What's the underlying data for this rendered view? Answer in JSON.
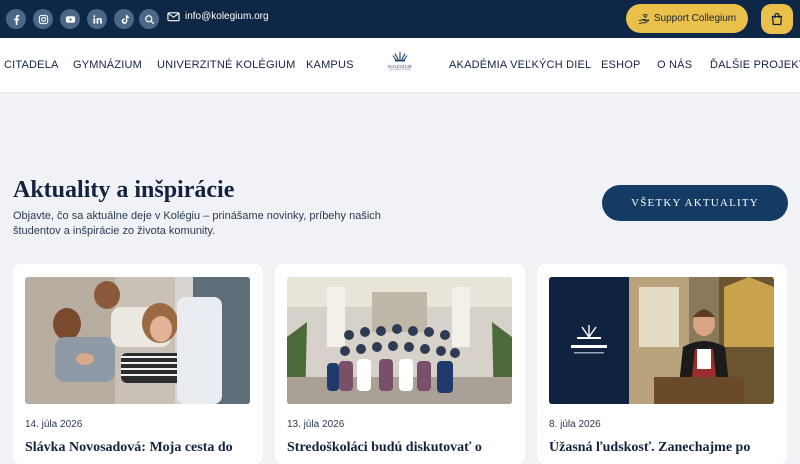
{
  "topbar": {
    "socials": [
      {
        "icon": "facebook-icon"
      },
      {
        "icon": "instagram-icon"
      },
      {
        "icon": "youtube-icon"
      },
      {
        "icon": "linkedin-icon"
      },
      {
        "icon": "tiktok-icon"
      },
      {
        "icon": "search-icon"
      }
    ],
    "email": "info@kolegium.org",
    "support_label": "Support Collegium",
    "bg_color": "#0f2747",
    "accent_color": "#e8c04a"
  },
  "nav": {
    "items_left": [
      "CITADELA",
      "GYMNÁZIUM",
      "UNIVERZITNÉ KOLÉGIUM",
      "KAMPUS"
    ],
    "items_right": [
      "AKADÉMIA VEĽKÝCH DIEL",
      "ESHOP",
      "O NÁS",
      "ĎALŠIE PROJEKTY"
    ],
    "logo_text": "KOLÉGIUM",
    "logo_subtext": "ANTONA NEUWIRTHA"
  },
  "section": {
    "title": "Aktuality a inšpirácie",
    "description": "Objavte, čo sa aktuálne deje v Kolégiu – prinášame novinky, príbehy našich študentov a inšpirácie zo života komunity.",
    "all_news_label": "VŠETKY AKTUALITY"
  },
  "cards": [
    {
      "date": "14. júla 2026",
      "title": "Slávka Novosadová: Moja cesta do"
    },
    {
      "date": "13. júla 2026",
      "title": "Stredoškoláci budú diskutovať o"
    },
    {
      "date": "8. júla 2026",
      "title": "Úžasná ľudskosť. Zanechajme po"
    }
  ]
}
